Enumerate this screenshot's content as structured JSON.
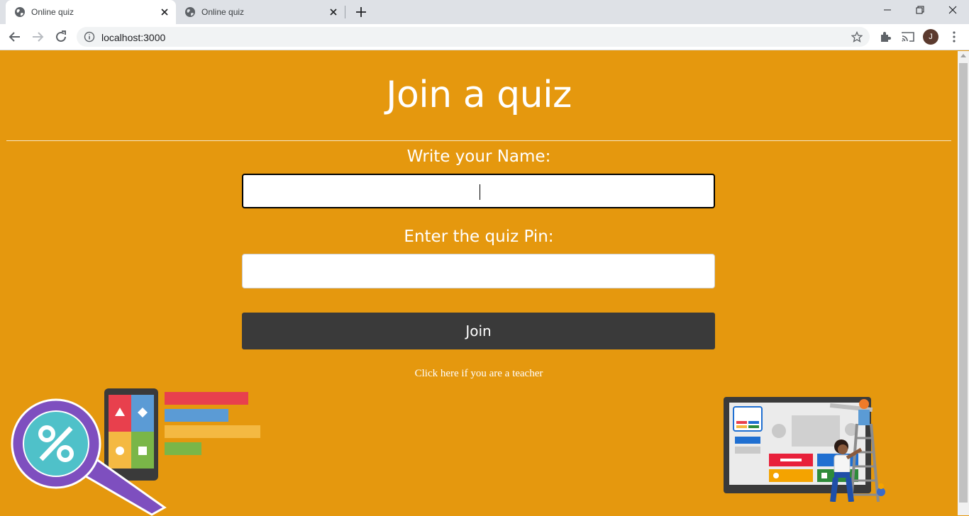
{
  "browser": {
    "tabs": [
      {
        "title": "Online quiz",
        "active": true
      },
      {
        "title": "Online quiz",
        "active": false
      }
    ],
    "url": "localhost:3000",
    "profile_initial": "J"
  },
  "page": {
    "title": "Join a quiz",
    "name_label": "Write your Name:",
    "name_value": "",
    "pin_label": "Enter the quiz Pin:",
    "pin_value": "",
    "join_label": "Join",
    "teacher_link": "Click here if you are a teacher"
  },
  "colors": {
    "background": "#e5980e",
    "button": "#3a3a3a",
    "text": "#ffffff"
  }
}
